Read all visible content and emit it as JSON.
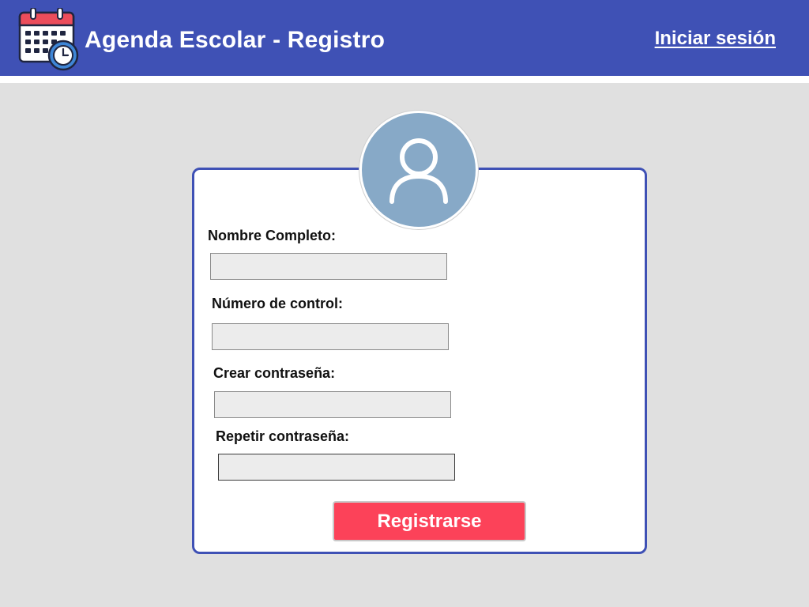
{
  "header": {
    "title": "Agenda Escolar - Registro",
    "login_link": "Iniciar sesión",
    "logo_icon": "calendar-clock-icon",
    "background_color": "#3f51b5"
  },
  "form": {
    "avatar_icon": "user-icon",
    "fields": [
      {
        "label": "Nombre Completo:",
        "value": "",
        "placeholder": ""
      },
      {
        "label": "Número de control:",
        "value": "",
        "placeholder": ""
      },
      {
        "label": "Crear contraseña:",
        "value": "",
        "placeholder": ""
      },
      {
        "label": "Repetir contraseña:",
        "value": "",
        "placeholder": ""
      }
    ],
    "submit_label": "Registrarse",
    "submit_color": "#fc4259"
  }
}
